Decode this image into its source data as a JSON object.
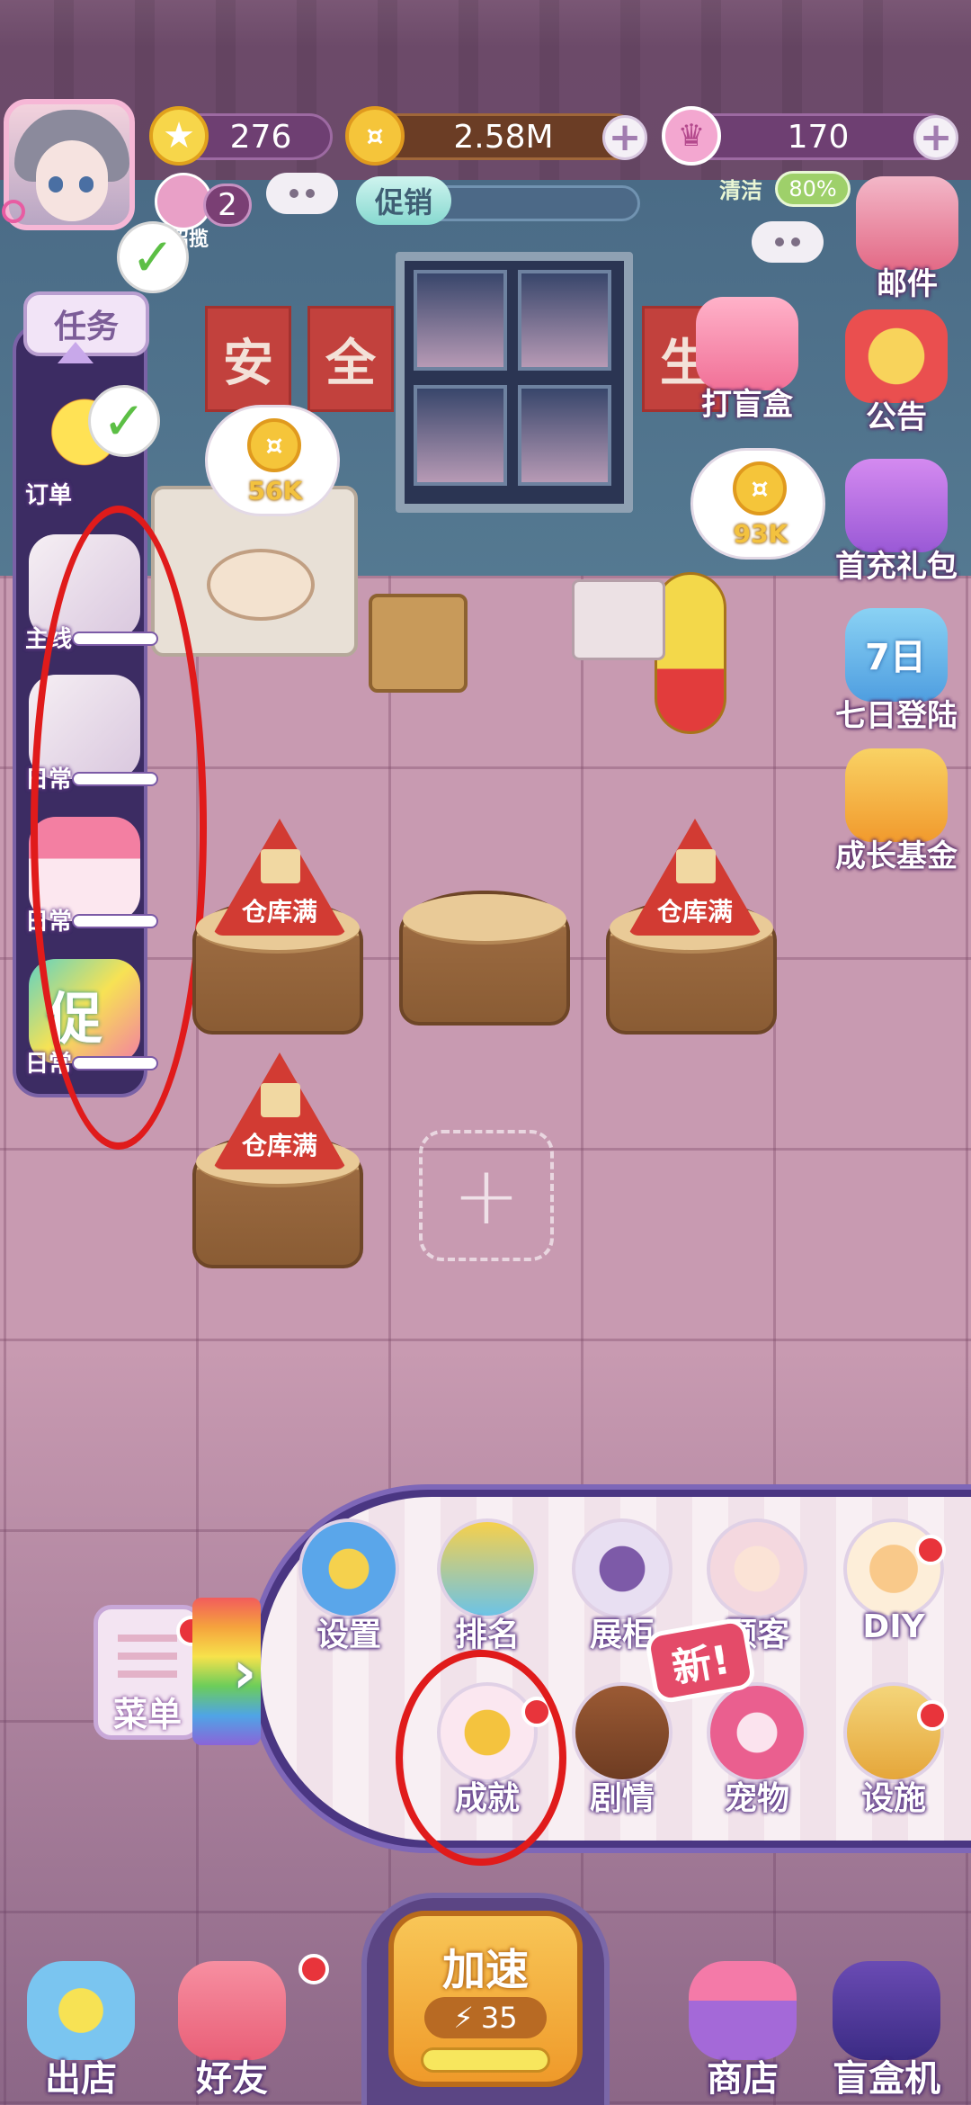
{
  "header": {
    "level": "276",
    "coins": "2.58M",
    "gems": "170",
    "customer_count": "2",
    "customer_tag": "招揽",
    "promo_label": "促销",
    "clean_label": "清洁",
    "clean_percent": "80%"
  },
  "sign_letters": [
    "安",
    "全",
    "生"
  ],
  "left_panel": {
    "task_label": "任务",
    "items": [
      {
        "label": "订单"
      },
      {
        "label": "主线"
      },
      {
        "label": "日常"
      },
      {
        "label": "日常"
      },
      {
        "label": "日常",
        "icon_text": "促"
      }
    ]
  },
  "right_panel": {
    "mail": "邮件",
    "items": [
      "打盲盒",
      "公告",
      "首充礼包",
      "七日登陆",
      "成长基金"
    ],
    "seven_day_badge": "7日"
  },
  "coin_bubbles": [
    "56K",
    "93K"
  ],
  "stations": {
    "warning_label": "仓库满",
    "empty_slot_icon": "+"
  },
  "menu": {
    "toggle_label": "菜单",
    "new_badge": "新!",
    "row1": [
      "设置",
      "排名",
      "展柜",
      "顾客",
      "DIY"
    ],
    "row2": [
      "成就",
      "剧情",
      "宠物",
      "设施"
    ]
  },
  "bottom_bar": {
    "exit_store": "出店",
    "friends": "好友",
    "speed_up": "加速",
    "speed_count": "35",
    "shop": "商店",
    "blind_box_machine": "盲盒机"
  },
  "colors": {
    "annotation_red": "#e01b1b",
    "notification_dot": "#e8343b",
    "warning_red": "#d23b33",
    "panel_purple": "#4a3682"
  }
}
